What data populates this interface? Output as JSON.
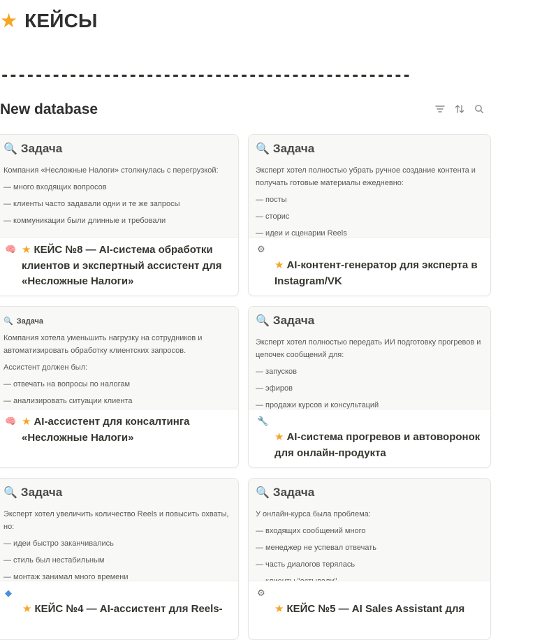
{
  "page": {
    "icon": "star-icon",
    "title": "КЕЙСЫ",
    "divider": "------------------------------------------------"
  },
  "database": {
    "title": "New database",
    "tools": [
      "filter-icon",
      "sort-icon",
      "search-icon"
    ]
  },
  "cards": [
    {
      "preview_title": "Задача",
      "preview_lines": [
        "Компания «Несложные Налоги» столкнулась с перегрузкой:",
        "— много входящих вопросов",
        "— клиенты часто задавали одни и те же запросы",
        "— коммуникации были длинные и требовали"
      ],
      "icon": "brain-icon",
      "star": "★",
      "title": "КЕЙС №8 — AI-система обработки клиентов и экспертный ассистент для «Несложные Налоги»"
    },
    {
      "preview_title": "Задача",
      "preview_lines": [
        "Эксперт хотел полностью убрать ручное создание контента и получать готовые материалы ежедневно:",
        "— посты",
        "— сторис",
        "— идеи и сценарии Reels"
      ],
      "icon": "gear-icon",
      "star": "★",
      "title": "AI-контент-генератор для эксперта в Instagram/VK"
    },
    {
      "preview_title": "Задача",
      "preview_lines": [
        "Компания хотела уменьшить нагрузку на сотрудников и автоматизировать обработку клиентских запросов.",
        "Ассистент должен был:",
        "— отвечать на вопросы по налогам",
        "— анализировать ситуации клиента"
      ],
      "icon": "brain-icon",
      "star": "★",
      "title": "AI-ассистент для консалтинга «Несложные Налоги»"
    },
    {
      "preview_title": "Задача",
      "preview_lines": [
        "Эксперт хотел полностью передать ИИ подготовку прогревов и цепочек сообщений для:",
        "— запусков",
        "— эфиров",
        "— продажи курсов и консультаций"
      ],
      "icon": "wrench-icon",
      "star": "★",
      "title": "AI-система прогревов и автоворонок для онлайн-продукта"
    },
    {
      "preview_title": "Задача",
      "preview_lines": [
        "Эксперт хотел увеличить количество Reels и повысить охваты, но:",
        "— идеи быстро заканчивались",
        "— стиль был нестабильным",
        "— монтаж занимал много времени"
      ],
      "icon": "diamond-icon",
      "star": "★",
      "title": "КЕЙС №4 — AI-ассистент для Reels-"
    },
    {
      "preview_title": "Задача",
      "preview_lines": [
        "У онлайн-курса была проблема:",
        "— входящих сообщений много",
        "— менеджер не успевал отвечать",
        "— часть диалогов терялась",
        "— клиенты \"остывали\""
      ],
      "icon": "gear-icon",
      "star": "★",
      "title": "КЕЙС №5 — AI Sales Assistant для"
    }
  ]
}
